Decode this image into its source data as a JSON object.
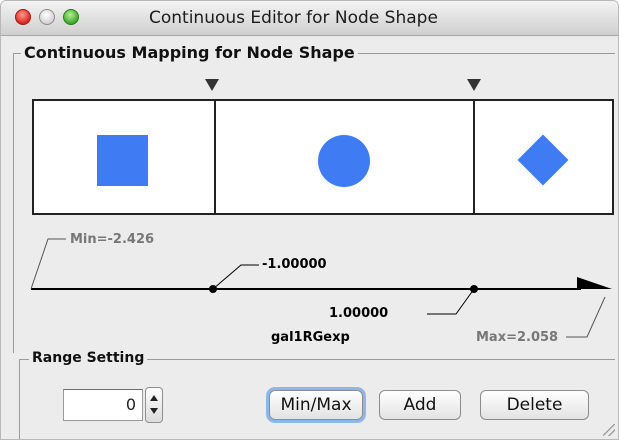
{
  "window": {
    "title": "Continuous Editor for Node Shape"
  },
  "mapping": {
    "group_label": "Continuous Mapping for Node Shape",
    "shapes": [
      "square",
      "circle",
      "diamond"
    ],
    "shape_color": "#3f7bf2",
    "min_label": "Min=-2.426",
    "max_label": "Max=2.058",
    "point1_label": "-1.00000",
    "point2_label": "1.00000",
    "attribute_label": "gal1RGexp"
  },
  "range_setting": {
    "group_label": "Range Setting",
    "spinner_value": "0",
    "min_max_button": "Min/Max",
    "add_button": "Add",
    "delete_button": "Delete"
  }
}
